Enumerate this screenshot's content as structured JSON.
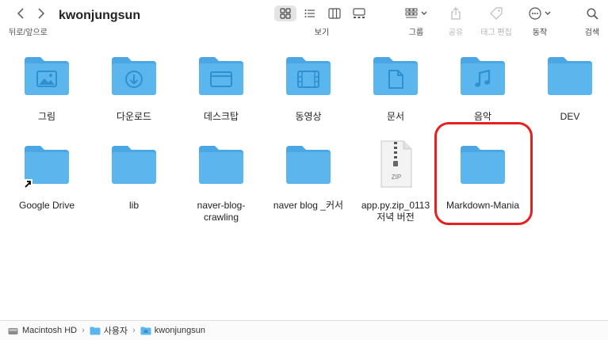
{
  "toolbar": {
    "back_forward_label": "뒤로/앞으로",
    "title": "kwonjungsun",
    "view_label": "보기",
    "group_label": "그룹",
    "share_label": "공유",
    "tag_edit_label": "태그 편집",
    "action_label": "동작",
    "search_label": "검색"
  },
  "items": [
    {
      "name": "그림",
      "icon": "pictures-folder-icon"
    },
    {
      "name": "다운로드",
      "icon": "downloads-folder-icon"
    },
    {
      "name": "데스크탑",
      "icon": "desktop-folder-icon"
    },
    {
      "name": "동영상",
      "icon": "movies-folder-icon"
    },
    {
      "name": "문서",
      "icon": "documents-folder-icon"
    },
    {
      "name": "음악",
      "icon": "music-folder-icon"
    },
    {
      "name": "DEV",
      "icon": "folder-icon"
    },
    {
      "name": "Google Drive",
      "icon": "alias-folder-icon"
    },
    {
      "name": "lib",
      "icon": "folder-icon"
    },
    {
      "name": "naver-blog-crawling",
      "icon": "folder-icon"
    },
    {
      "name": "naver blog _커서",
      "icon": "folder-icon"
    },
    {
      "name": "app.py.zip_0113 저녁 버전",
      "icon": "zip-file-icon"
    },
    {
      "name": "Markdown-Mania",
      "icon": "folder-icon"
    }
  ],
  "pathbar": {
    "crumbs": [
      "Macintosh HD",
      "사용자",
      "kwonjungsun"
    ]
  },
  "colors": {
    "folder": "#5bb6ee",
    "folder_tab": "#4aa7e3",
    "highlight": "#e5201e"
  }
}
